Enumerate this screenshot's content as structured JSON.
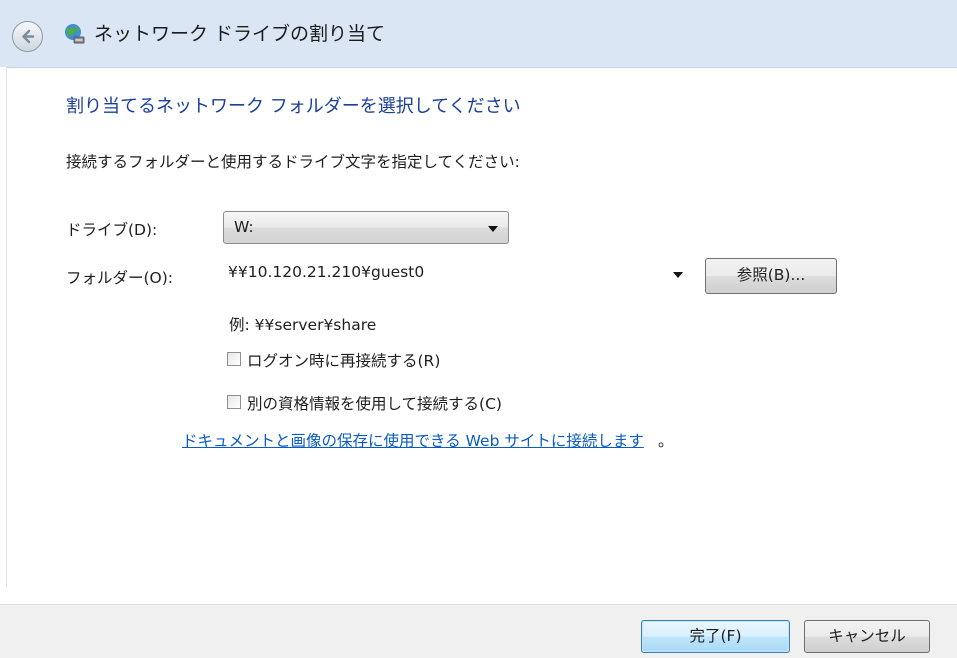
{
  "window": {
    "title": "ネットワーク ドライブの割り当て",
    "back_icon": "back-arrow-icon",
    "app_icon": "network-drive-icon"
  },
  "content": {
    "heading": "割り当てるネットワーク フォルダーを選択してください",
    "instruction": "接続するフォルダーと使用するドライブ文字を指定してください:",
    "drive_label": "ドライブ(D):",
    "drive_value": "W:",
    "folder_label": "フォルダー(O):",
    "folder_value": "¥¥10.120.21.210¥guest0",
    "browse_label": "参照(B)...",
    "example_text": "例: ¥¥server¥share",
    "reconnect_label": "ログオン時に再接続する(R)",
    "reconnect_checked": false,
    "credentials_label": "別の資格情報を使用して接続する(C)",
    "credentials_checked": false,
    "web_link": "ドキュメントと画像の保存に使用できる Web サイトに接続します",
    "web_link_suffix": "。"
  },
  "footer": {
    "finish_label": "完了(F)",
    "cancel_label": "キャンセル"
  },
  "colors": {
    "heading": "#1a3e99",
    "link": "#0a5bc4",
    "titlebar": "#dbe6f4",
    "footer": "#f0f0f0"
  }
}
